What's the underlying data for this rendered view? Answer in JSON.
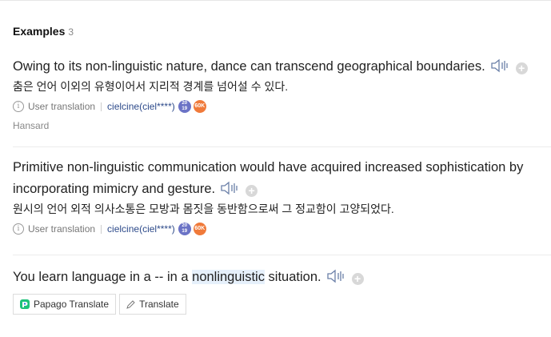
{
  "header": {
    "title": "Examples",
    "count": "3"
  },
  "examples": [
    {
      "en": "Owing to its non-linguistic nature, dance can transcend geographical boundaries.",
      "ko": "춤은 언어 이외의 유형이어서 지리적 경계를 넘어설 수 있다.",
      "meta": {
        "type": "User translation",
        "user": "cielcine(ciel****)",
        "badge1_top": "20",
        "badge1_bottom": "19",
        "badge2": "60K"
      },
      "source": "Hansard"
    },
    {
      "en": "Primitive non-linguistic communication would have acquired increased sophistication by incorporating mimicry and gesture.",
      "ko": "원시의 언어 외적 의사소통은 모방과 몸짓을 동반함으로써 그 정교함이 고양되었다.",
      "meta": {
        "type": "User translation",
        "user": "cielcine(ciel****)",
        "badge1_top": "20",
        "badge1_bottom": "19",
        "badge2": "60K"
      }
    },
    {
      "en_before": "You learn language in a -- in a ",
      "en_highlight": "nonlinguistic",
      "en_after": " situation."
    }
  ],
  "buttons": {
    "papago": "Papago Translate",
    "translate": "Translate"
  },
  "icons": {
    "speaker": "speaker-icon",
    "plus": "plus-icon",
    "info": "info-icon",
    "pencil": "pencil-icon",
    "papago": "papago-logo-icon"
  }
}
